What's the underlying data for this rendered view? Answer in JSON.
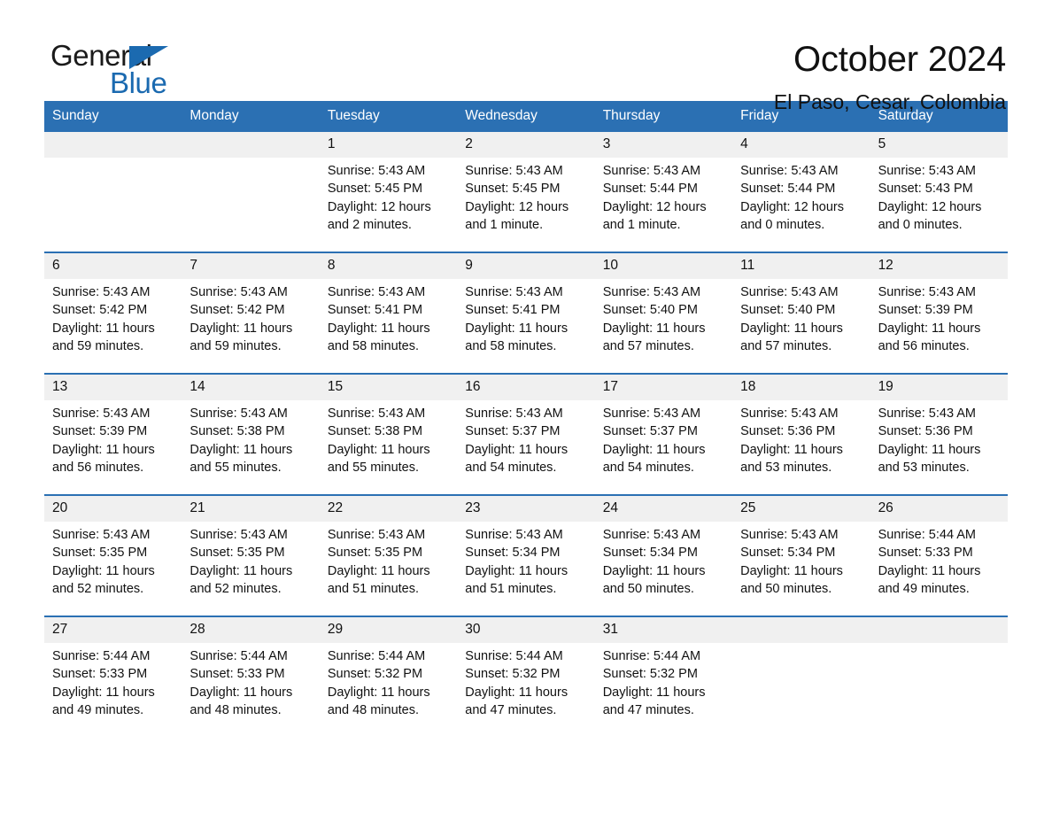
{
  "brand": {
    "word_one": "General",
    "word_two": "Blue",
    "triangle_icon": "brand-triangle-icon",
    "accent_color": "#1b6ab0"
  },
  "header": {
    "title": "October 2024",
    "subtitle": "El Paso, Cesar, Colombia"
  },
  "calendar": {
    "header_color": "#2b70b3",
    "daynum_band_color": "#f0f0f0",
    "weekday_names": [
      "Sunday",
      "Monday",
      "Tuesday",
      "Wednesday",
      "Thursday",
      "Friday",
      "Saturday"
    ],
    "weeks": [
      [
        {
          "day": "",
          "empty": true
        },
        {
          "day": "",
          "empty": true
        },
        {
          "day": "1",
          "sunrise": "Sunrise: 5:43 AM",
          "sunset": "Sunset: 5:45 PM",
          "daylight": "Daylight: 12 hours and 2 minutes."
        },
        {
          "day": "2",
          "sunrise": "Sunrise: 5:43 AM",
          "sunset": "Sunset: 5:45 PM",
          "daylight": "Daylight: 12 hours and 1 minute."
        },
        {
          "day": "3",
          "sunrise": "Sunrise: 5:43 AM",
          "sunset": "Sunset: 5:44 PM",
          "daylight": "Daylight: 12 hours and 1 minute."
        },
        {
          "day": "4",
          "sunrise": "Sunrise: 5:43 AM",
          "sunset": "Sunset: 5:44 PM",
          "daylight": "Daylight: 12 hours and 0 minutes."
        },
        {
          "day": "5",
          "sunrise": "Sunrise: 5:43 AM",
          "sunset": "Sunset: 5:43 PM",
          "daylight": "Daylight: 12 hours and 0 minutes."
        }
      ],
      [
        {
          "day": "6",
          "sunrise": "Sunrise: 5:43 AM",
          "sunset": "Sunset: 5:42 PM",
          "daylight": "Daylight: 11 hours and 59 minutes."
        },
        {
          "day": "7",
          "sunrise": "Sunrise: 5:43 AM",
          "sunset": "Sunset: 5:42 PM",
          "daylight": "Daylight: 11 hours and 59 minutes."
        },
        {
          "day": "8",
          "sunrise": "Sunrise: 5:43 AM",
          "sunset": "Sunset: 5:41 PM",
          "daylight": "Daylight: 11 hours and 58 minutes."
        },
        {
          "day": "9",
          "sunrise": "Sunrise: 5:43 AM",
          "sunset": "Sunset: 5:41 PM",
          "daylight": "Daylight: 11 hours and 58 minutes."
        },
        {
          "day": "10",
          "sunrise": "Sunrise: 5:43 AM",
          "sunset": "Sunset: 5:40 PM",
          "daylight": "Daylight: 11 hours and 57 minutes."
        },
        {
          "day": "11",
          "sunrise": "Sunrise: 5:43 AM",
          "sunset": "Sunset: 5:40 PM",
          "daylight": "Daylight: 11 hours and 57 minutes."
        },
        {
          "day": "12",
          "sunrise": "Sunrise: 5:43 AM",
          "sunset": "Sunset: 5:39 PM",
          "daylight": "Daylight: 11 hours and 56 minutes."
        }
      ],
      [
        {
          "day": "13",
          "sunrise": "Sunrise: 5:43 AM",
          "sunset": "Sunset: 5:39 PM",
          "daylight": "Daylight: 11 hours and 56 minutes."
        },
        {
          "day": "14",
          "sunrise": "Sunrise: 5:43 AM",
          "sunset": "Sunset: 5:38 PM",
          "daylight": "Daylight: 11 hours and 55 minutes."
        },
        {
          "day": "15",
          "sunrise": "Sunrise: 5:43 AM",
          "sunset": "Sunset: 5:38 PM",
          "daylight": "Daylight: 11 hours and 55 minutes."
        },
        {
          "day": "16",
          "sunrise": "Sunrise: 5:43 AM",
          "sunset": "Sunset: 5:37 PM",
          "daylight": "Daylight: 11 hours and 54 minutes."
        },
        {
          "day": "17",
          "sunrise": "Sunrise: 5:43 AM",
          "sunset": "Sunset: 5:37 PM",
          "daylight": "Daylight: 11 hours and 54 minutes."
        },
        {
          "day": "18",
          "sunrise": "Sunrise: 5:43 AM",
          "sunset": "Sunset: 5:36 PM",
          "daylight": "Daylight: 11 hours and 53 minutes."
        },
        {
          "day": "19",
          "sunrise": "Sunrise: 5:43 AM",
          "sunset": "Sunset: 5:36 PM",
          "daylight": "Daylight: 11 hours and 53 minutes."
        }
      ],
      [
        {
          "day": "20",
          "sunrise": "Sunrise: 5:43 AM",
          "sunset": "Sunset: 5:35 PM",
          "daylight": "Daylight: 11 hours and 52 minutes."
        },
        {
          "day": "21",
          "sunrise": "Sunrise: 5:43 AM",
          "sunset": "Sunset: 5:35 PM",
          "daylight": "Daylight: 11 hours and 52 minutes."
        },
        {
          "day": "22",
          "sunrise": "Sunrise: 5:43 AM",
          "sunset": "Sunset: 5:35 PM",
          "daylight": "Daylight: 11 hours and 51 minutes."
        },
        {
          "day": "23",
          "sunrise": "Sunrise: 5:43 AM",
          "sunset": "Sunset: 5:34 PM",
          "daylight": "Daylight: 11 hours and 51 minutes."
        },
        {
          "day": "24",
          "sunrise": "Sunrise: 5:43 AM",
          "sunset": "Sunset: 5:34 PM",
          "daylight": "Daylight: 11 hours and 50 minutes."
        },
        {
          "day": "25",
          "sunrise": "Sunrise: 5:43 AM",
          "sunset": "Sunset: 5:34 PM",
          "daylight": "Daylight: 11 hours and 50 minutes."
        },
        {
          "day": "26",
          "sunrise": "Sunrise: 5:44 AM",
          "sunset": "Sunset: 5:33 PM",
          "daylight": "Daylight: 11 hours and 49 minutes."
        }
      ],
      [
        {
          "day": "27",
          "sunrise": "Sunrise: 5:44 AM",
          "sunset": "Sunset: 5:33 PM",
          "daylight": "Daylight: 11 hours and 49 minutes."
        },
        {
          "day": "28",
          "sunrise": "Sunrise: 5:44 AM",
          "sunset": "Sunset: 5:33 PM",
          "daylight": "Daylight: 11 hours and 48 minutes."
        },
        {
          "day": "29",
          "sunrise": "Sunrise: 5:44 AM",
          "sunset": "Sunset: 5:32 PM",
          "daylight": "Daylight: 11 hours and 48 minutes."
        },
        {
          "day": "30",
          "sunrise": "Sunrise: 5:44 AM",
          "sunset": "Sunset: 5:32 PM",
          "daylight": "Daylight: 11 hours and 47 minutes."
        },
        {
          "day": "31",
          "sunrise": "Sunrise: 5:44 AM",
          "sunset": "Sunset: 5:32 PM",
          "daylight": "Daylight: 11 hours and 47 minutes."
        },
        {
          "day": "",
          "empty": true
        },
        {
          "day": "",
          "empty": true
        }
      ]
    ]
  }
}
